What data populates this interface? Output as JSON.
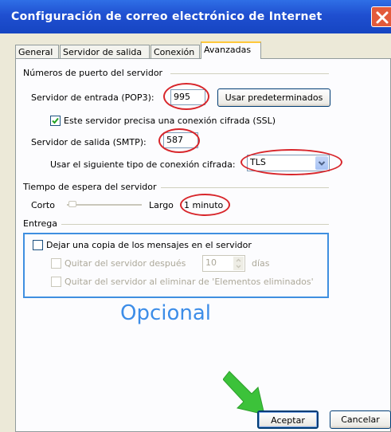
{
  "window": {
    "title": "Configuración de correo electrónico de Internet",
    "close": "×"
  },
  "tabs": [
    {
      "label": "General"
    },
    {
      "label": "Servidor de salida"
    },
    {
      "label": "Conexión"
    },
    {
      "label": "Avanzadas"
    }
  ],
  "active_tab": "Avanzadas",
  "ports": {
    "group_title": "Números de puerto del servidor",
    "incoming_label": "Servidor de entrada (POP3):",
    "incoming_value": "995",
    "defaults_button": "Usar predeterminados",
    "ssl_label": "Este servidor precisa una conexión cifrada (SSL)",
    "ssl_checked": true,
    "outgoing_label": "Servidor de salida (SMTP):",
    "outgoing_value": "587",
    "encryption_label": "Usar el siguiente tipo de conexión cifrada:",
    "encryption_value": "TLS"
  },
  "timeout": {
    "group_title": "Tiempo de espera del servidor",
    "short_label": "Corto",
    "long_label": "Largo",
    "value": "1 minuto"
  },
  "delivery": {
    "group_title": "Entrega",
    "keep_copy_label": "Dejar una copia de los mensajes en el servidor",
    "keep_copy_checked": false,
    "remove_after_label": "Quitar del servidor después",
    "remove_after_days": "10",
    "days_label": "días",
    "remove_deleted_label": "Quitar del servidor al eliminar de 'Elementos eliminados'"
  },
  "annotation": {
    "text": "Opcional",
    "color": "#3D8DE8",
    "circle_color": "#D8262B",
    "arrow_color": "#3CC23A"
  },
  "buttons": {
    "ok": "Aceptar",
    "cancel": "Cancelar"
  },
  "colors": {
    "titlebar": "#1F4FD0",
    "dialog_bg": "#ECE9D8",
    "tab_accent": "#FFC83C"
  }
}
